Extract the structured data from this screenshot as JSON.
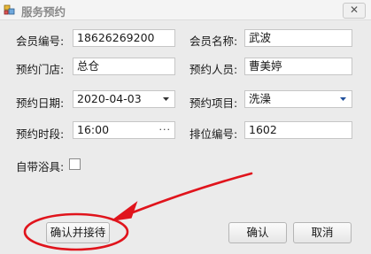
{
  "window": {
    "title": "服务预约",
    "close_glyph": "✕"
  },
  "form": {
    "member_no": {
      "label": "会员编号:",
      "value": "18626269200"
    },
    "member_name": {
      "label": "会员名称:",
      "value": "武波"
    },
    "store": {
      "label": "预约门店:",
      "value": "总仓"
    },
    "staff": {
      "label": "预约人员:",
      "value": "曹美婷"
    },
    "date": {
      "label": "预约日期:",
      "value": "2020-04-03"
    },
    "item": {
      "label": "预约项目:",
      "value": "洗澡"
    },
    "time": {
      "label": "预约时段:",
      "value": "16:00",
      "picker_glyph": "···"
    },
    "queue_no": {
      "label": "排位编号:",
      "value": "1602"
    },
    "own_bath": {
      "label": "自带浴具:",
      "checked": false
    }
  },
  "buttons": {
    "confirm_accept": "确认并接待",
    "confirm": "确认",
    "cancel": "取消"
  },
  "annotation": {
    "color": "#e0141c"
  }
}
